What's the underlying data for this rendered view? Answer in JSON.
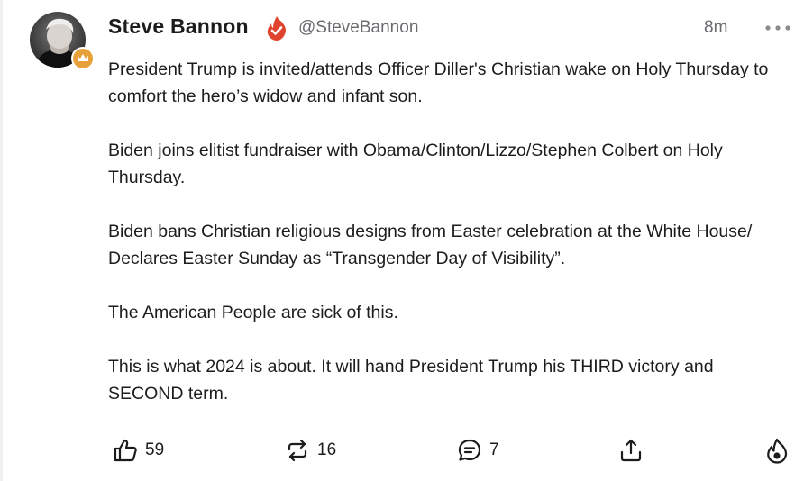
{
  "post": {
    "author_name": "Steve Bannon",
    "handle": "@SteveBannon",
    "time": "8m",
    "paragraphs": [
      "President Trump is invited/attends Officer Diller's Christian wake on Holy Thursday to comfort the hero’s widow and infant son.",
      "Biden joins elitist fundraiser with Obama/Clinton/Lizzo/Stephen Colbert on Holy Thursday.",
      "Biden bans Christian religious designs from Easter celebration at the White House/ Declares Easter Sunday as “Transgender Day of Visibility”.",
      "The American People are sick of this.",
      "This is what 2024 is about. It will hand President Trump his THIRD victory and SECOND term."
    ]
  },
  "actions": {
    "like_count": "59",
    "repost_count": "16",
    "comment_count": "7"
  },
  "icons": {
    "verified": "verified-flame-icon",
    "badge": "crown-badge-icon",
    "more": "more-dots-icon",
    "like": "thumbs-up-icon",
    "repost": "repost-icon",
    "comment": "comment-icon",
    "share": "share-icon",
    "boost": "flame-icon"
  },
  "colors": {
    "verified": "#e0442f",
    "badge": "#e8a13a",
    "text": "#1c1c1e",
    "muted": "#6b6b70"
  }
}
